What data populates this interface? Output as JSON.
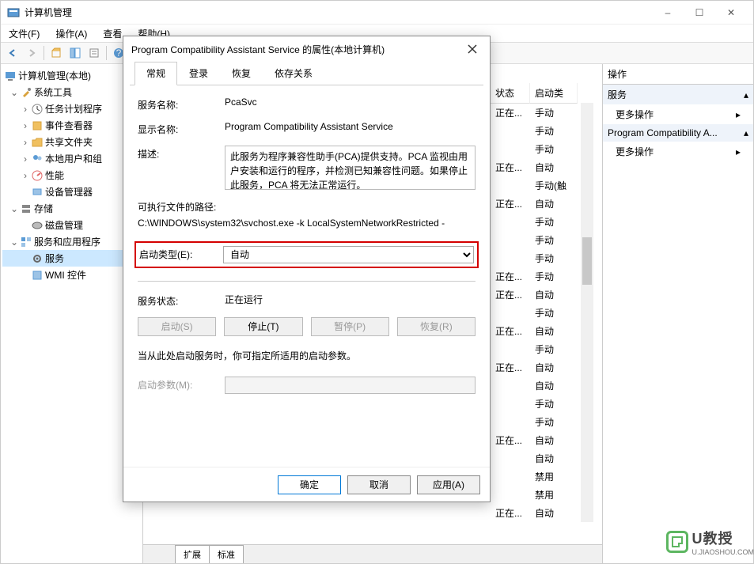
{
  "window": {
    "title": "计算机管理",
    "win_controls": {
      "min": "–",
      "max": "☐",
      "close": "✕"
    }
  },
  "menu": {
    "file": "文件(F)",
    "action": "操作(A)",
    "view": "查看",
    "help": "帮助(H)"
  },
  "tree": {
    "root": "计算机管理(本地)",
    "systools": "系统工具",
    "task": "任务计划程序",
    "event": "事件查看器",
    "shared": "共享文件夹",
    "users": "本地用户和组",
    "perf": "性能",
    "devmgr": "设备管理器",
    "storage": "存储",
    "diskmgmt": "磁盘管理",
    "servapps": "服务和应用程序",
    "services": "服务",
    "wmi": "WMI 控件"
  },
  "list_headers": {
    "status": "状态",
    "startup": "启动类"
  },
  "service_rows": [
    {
      "status": "正在...",
      "startup": "手动"
    },
    {
      "status": "",
      "startup": "手动"
    },
    {
      "status": "",
      "startup": "手动"
    },
    {
      "status": "正在...",
      "startup": "自动"
    },
    {
      "status": "",
      "startup": "手动(触"
    },
    {
      "status": "正在...",
      "startup": "自动"
    },
    {
      "status": "",
      "startup": "手动"
    },
    {
      "status": "",
      "startup": "手动"
    },
    {
      "status": "",
      "startup": "手动"
    },
    {
      "status": "正在...",
      "startup": "手动"
    },
    {
      "status": "正在...",
      "startup": "自动"
    },
    {
      "status": "",
      "startup": "手动"
    },
    {
      "status": "正在...",
      "startup": "自动"
    },
    {
      "status": "",
      "startup": "手动"
    },
    {
      "status": "正在...",
      "startup": "自动"
    },
    {
      "status": "",
      "startup": "自动"
    },
    {
      "status": "",
      "startup": "手动"
    },
    {
      "status": "",
      "startup": "手动"
    },
    {
      "status": "正在...",
      "startup": "自动"
    },
    {
      "status": "",
      "startup": "自动"
    },
    {
      "status": "",
      "startup": "禁用"
    },
    {
      "status": "",
      "startup": "禁用"
    },
    {
      "status": "正在...",
      "startup": "自动"
    }
  ],
  "tabs_bottom": {
    "extended": "扩展",
    "standard": "标准"
  },
  "actions": {
    "header": "操作",
    "group1": "服务",
    "more1": "更多操作",
    "group2": "Program Compatibility A...",
    "more2": "更多操作"
  },
  "dialog": {
    "title": "Program Compatibility Assistant Service 的属性(本地计算机)",
    "tabs": {
      "general": "常规",
      "logon": "登录",
      "recovery": "恢复",
      "deps": "依存关系"
    },
    "svc_name_lbl": "服务名称:",
    "svc_name": "PcaSvc",
    "disp_name_lbl": "显示名称:",
    "disp_name": "Program Compatibility Assistant Service",
    "desc_lbl": "描述:",
    "desc": "此服务为程序兼容性助手(PCA)提供支持。PCA 监视由用户安装和运行的程序，并检测已知兼容性问题。如果停止此服务，PCA 将无法正常运行。",
    "exe_path_lbl": "可执行文件的路径:",
    "exe_path": "C:\\WINDOWS\\system32\\svchost.exe -k LocalSystemNetworkRestricted -",
    "startup_lbl": "启动类型(E):",
    "startup_value": "自动",
    "status_lbl": "服务状态:",
    "status_value": "正在运行",
    "btn_start": "启动(S)",
    "btn_stop": "停止(T)",
    "btn_pause": "暂停(P)",
    "btn_resume": "恢复(R)",
    "hint": "当从此处启动服务时，你可指定所适用的启动参数。",
    "param_lbl": "启动参数(M):",
    "ok": "确定",
    "cancel": "取消",
    "apply": "应用(A)"
  },
  "watermark": {
    "text": "U教授",
    "sub": "U.JIAOSHOU.COM"
  }
}
